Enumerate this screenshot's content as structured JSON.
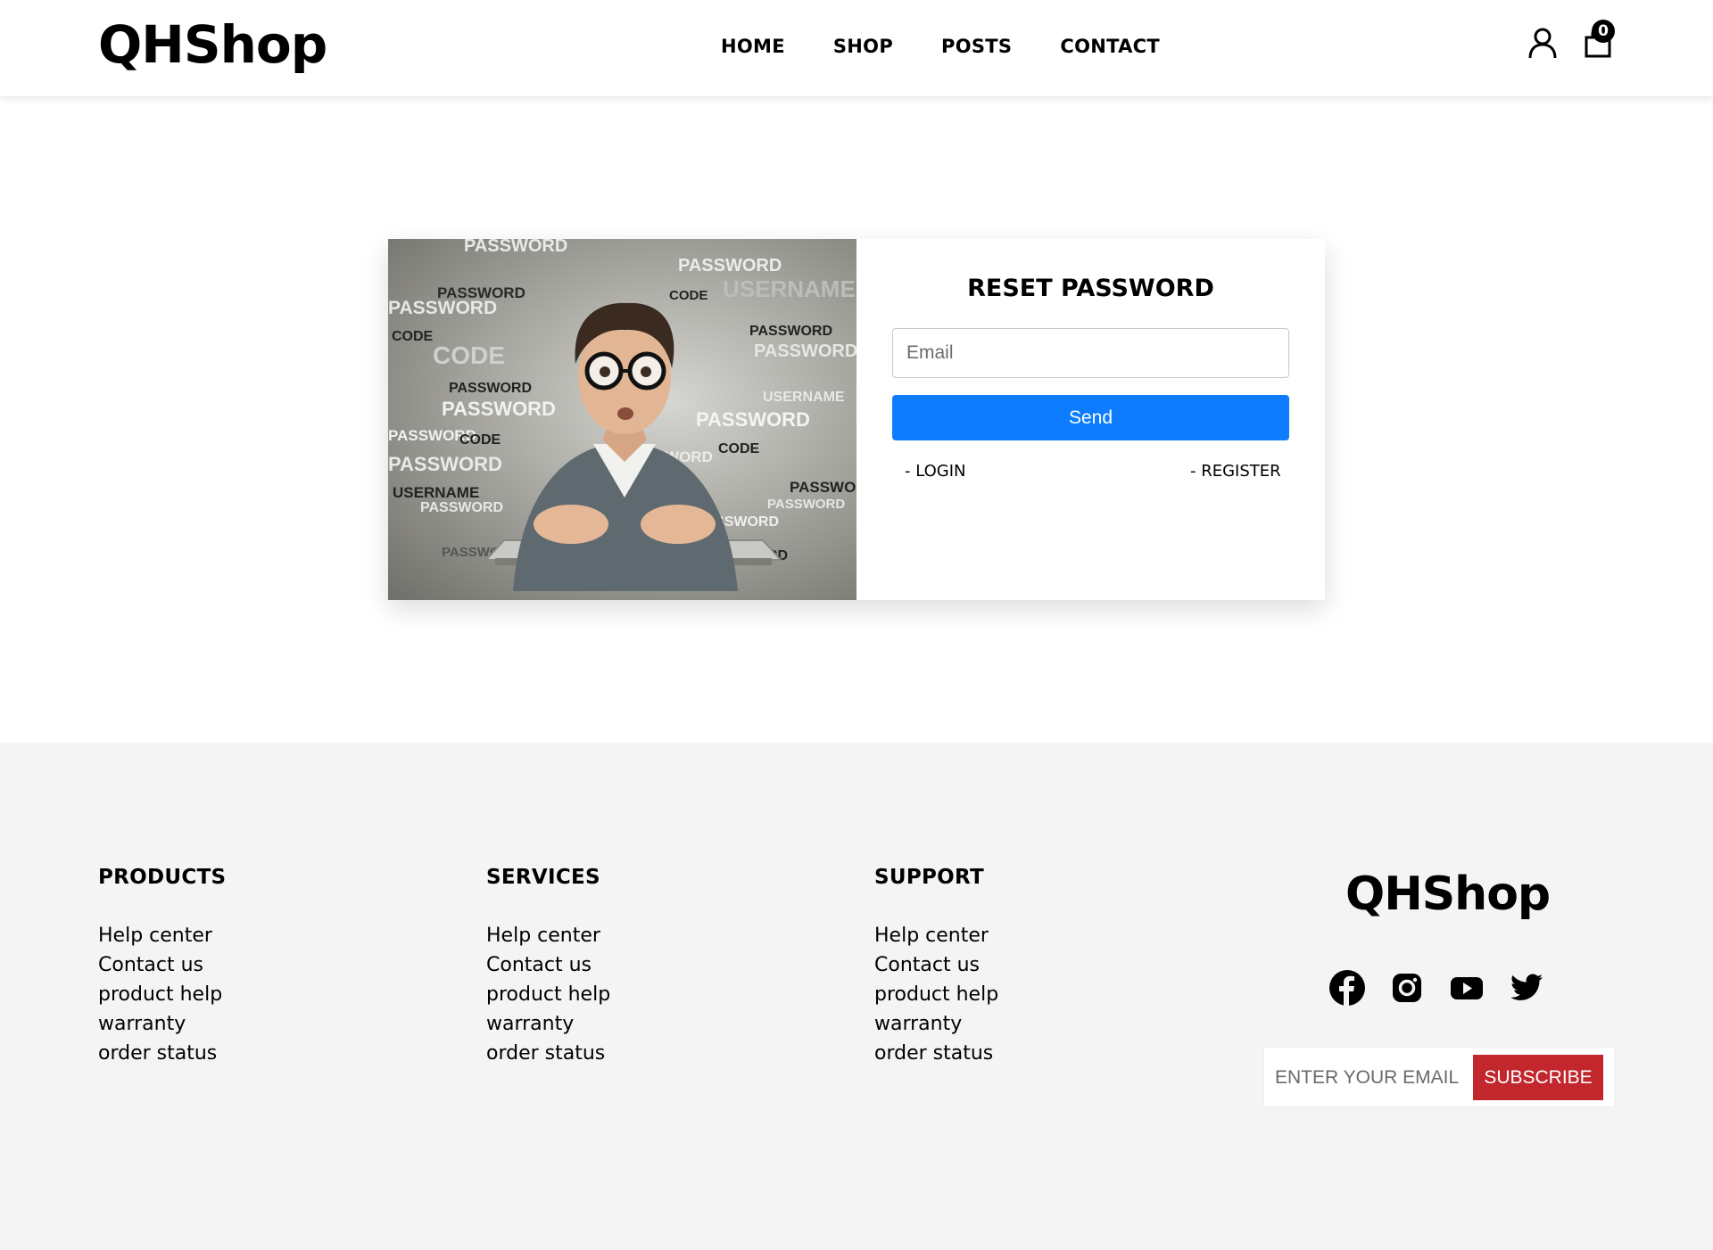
{
  "header": {
    "logo": "QHShop",
    "nav": [
      "HOME",
      "SHOP",
      "POSTS",
      "CONTACT"
    ],
    "cart_count": "0",
    "icons": {
      "account": "user-icon",
      "cart": "shopping-bag-icon"
    }
  },
  "reset": {
    "title": "RESET PASSWORD",
    "email_placeholder": "Email",
    "send_label": "Send",
    "login_label": "- LOGIN",
    "register_label": "- REGISTER",
    "image_words": [
      "PASSWORD",
      "USERNAME",
      "CODE"
    ]
  },
  "footer": {
    "columns": [
      {
        "heading": "PRODUCTS",
        "links": [
          "Help center",
          "Contact us",
          "product help",
          "warranty",
          "order status"
        ]
      },
      {
        "heading": "SERVICES",
        "links": [
          "Help center",
          "Contact us",
          "product help",
          "warranty",
          "order status"
        ]
      },
      {
        "heading": "SUPPORT",
        "links": [
          "Help center",
          "Contact us",
          "product help",
          "warranty",
          "order status"
        ]
      }
    ],
    "logo": "QHShop",
    "socials": [
      "facebook-icon",
      "instagram-icon",
      "youtube-icon",
      "twitter-icon"
    ],
    "subscribe_placeholder": "ENTER YOUR EMAIL",
    "subscribe_label": "SUBSCRIBE"
  },
  "colors": {
    "primary_button": "#0d7cff",
    "subscribe_button": "#c1272d",
    "footer_bg": "#f4f4f4"
  }
}
